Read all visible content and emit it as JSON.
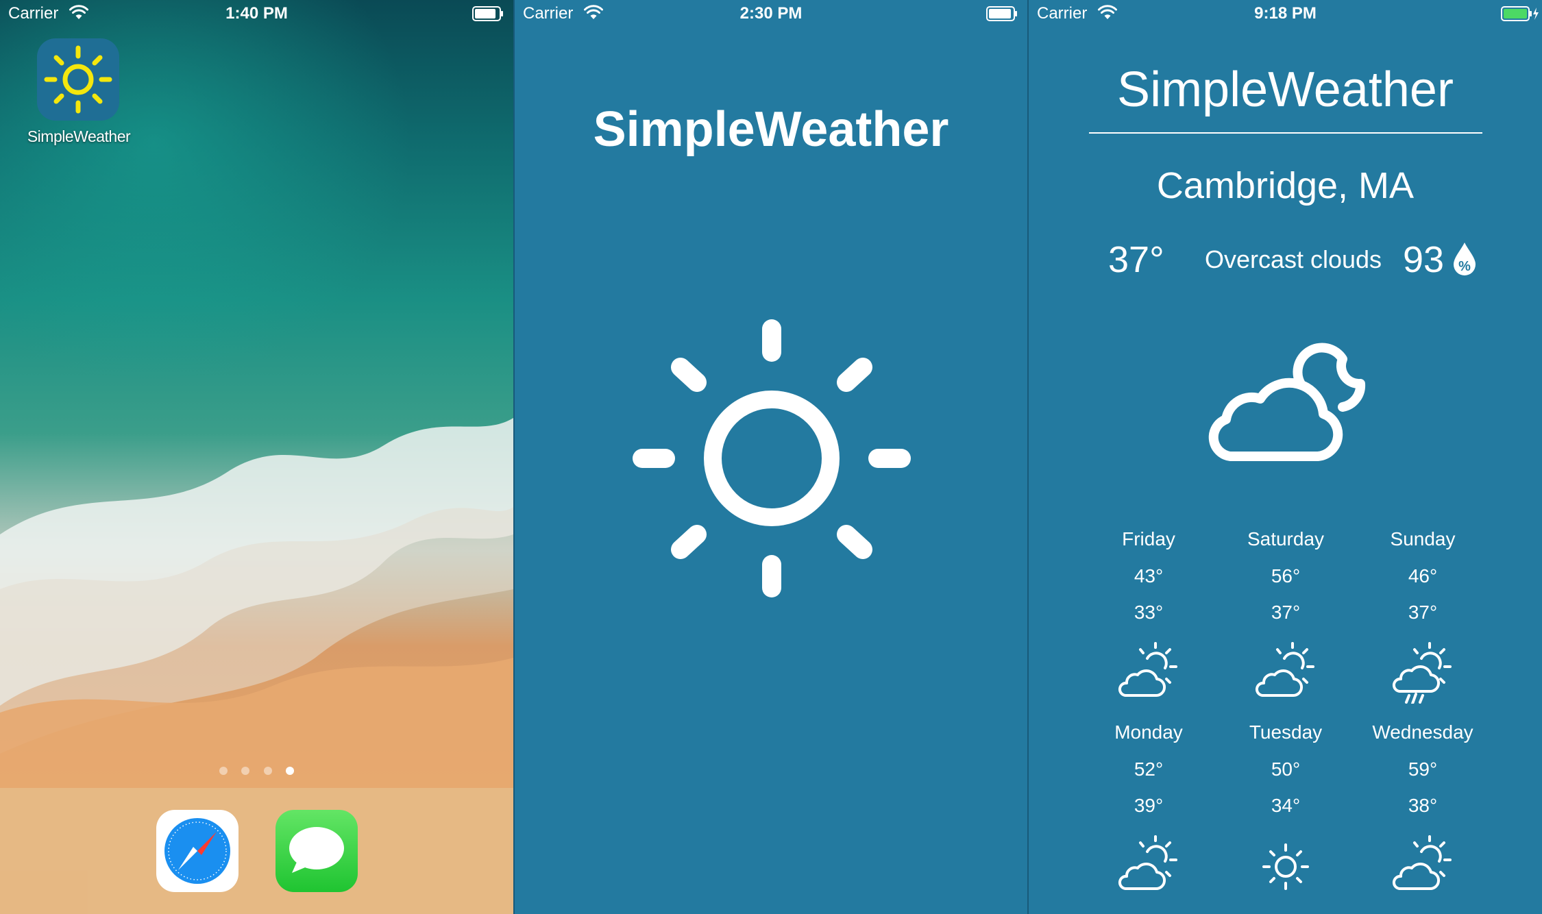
{
  "screens": [
    {
      "status_bar": {
        "carrier": "Carrier",
        "time": "1:40 PM"
      },
      "home": {
        "app_label": "SimpleWeather",
        "page_count": 4,
        "active_page": 4,
        "dock_apps": [
          "safari-icon",
          "messages-icon"
        ]
      }
    },
    {
      "status_bar": {
        "carrier": "Carrier",
        "time": "2:30 PM"
      },
      "launch": {
        "title": "SimpleWeather",
        "icon": "sun-icon"
      }
    },
    {
      "status_bar": {
        "carrier": "Carrier",
        "time": "9:18 PM",
        "battery": "charging"
      },
      "weather": {
        "title": "SimpleWeather",
        "city": "Cambridge, MA",
        "temperature": "37°",
        "description": "Overcast clouds",
        "humidity": "93",
        "current_icon": "cloud-moon-icon",
        "forecast": [
          {
            "day": "Friday",
            "high": "43°",
            "low": "33°",
            "icon": "partly-cloudy-icon"
          },
          {
            "day": "Saturday",
            "high": "56°",
            "low": "37°",
            "icon": "partly-cloudy-icon"
          },
          {
            "day": "Sunday",
            "high": "46°",
            "low": "37°",
            "icon": "rain-sun-icon"
          },
          {
            "day": "Monday",
            "high": "52°",
            "low": "39°",
            "icon": "partly-cloudy-icon"
          },
          {
            "day": "Tuesday",
            "high": "50°",
            "low": "34°",
            "icon": "sun-icon"
          },
          {
            "day": "Wednesday",
            "high": "59°",
            "low": "38°",
            "icon": "partly-cloudy-icon"
          }
        ]
      }
    }
  ],
  "colors": {
    "weather_background": "#237aa0",
    "app_icon_background": "#1f6e95",
    "app_icon_sun": "#f4e70d",
    "dock": "#f5be82",
    "battery_charging": "#4cd964"
  }
}
